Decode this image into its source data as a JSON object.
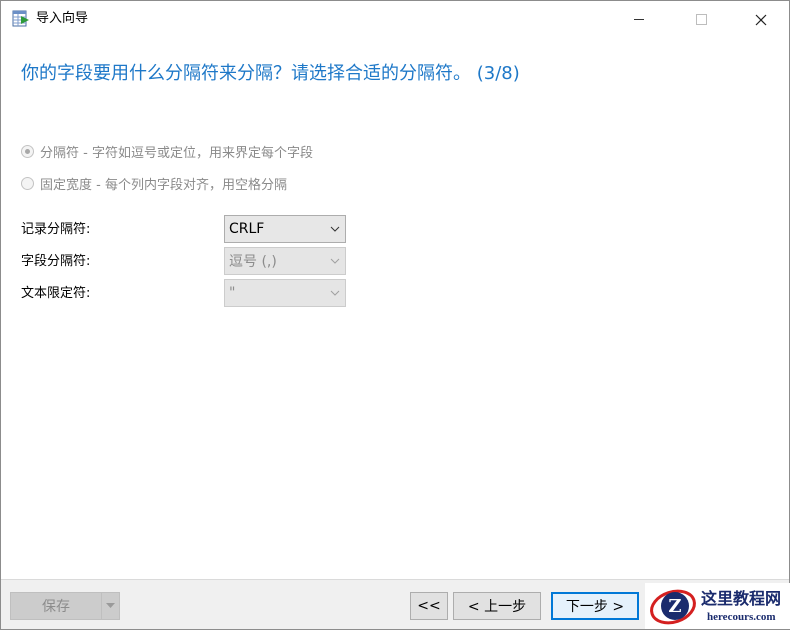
{
  "window": {
    "title": "导入向导",
    "close_glyph": "✕"
  },
  "heading": "你的字段要用什么分隔符来分隔？请选择合适的分隔符。 (3/8)",
  "options": {
    "delimited_label": "分隔符 - 字符如逗号或定位，用来界定每个字段",
    "fixed_width_label": "固定宽度 - 每个列内字段对齐，用空格分隔",
    "selected": "delimited"
  },
  "fields": {
    "record_delimiter": {
      "label": "记录分隔符:",
      "value": "CRLF"
    },
    "field_delimiter": {
      "label": "字段分隔符:",
      "value": "逗号 (,)"
    },
    "text_qualifier": {
      "label": "文本限定符:",
      "value": "\""
    }
  },
  "footer": {
    "save_label": "保存",
    "first_label": "<<",
    "prev_label": "< 上一步",
    "next_label": "下一步 >"
  },
  "watermark": {
    "cn": "这里教程网",
    "en": "herecours.com"
  },
  "colors": {
    "heading": "#1e78c8",
    "focus_border": "#0078d7",
    "watermark": "#1a2b6d",
    "watermark_accent": "#d42020"
  },
  "icons": {
    "app": "table-import-icon",
    "combo_arrow": "chevron-down-icon",
    "close": "close-icon"
  }
}
